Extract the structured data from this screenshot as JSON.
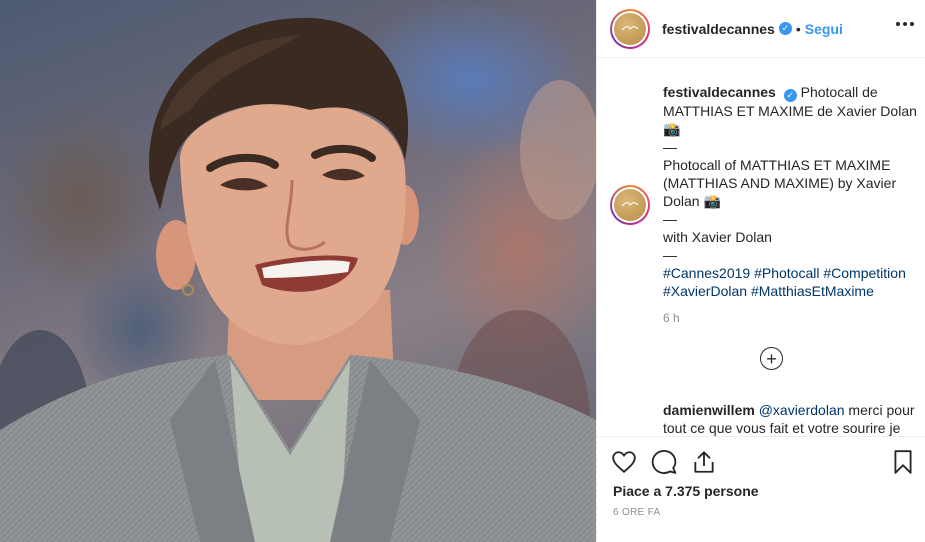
{
  "post": {
    "username": "festivaldecannes",
    "verified_icon": "verified-badge-icon",
    "separator": "•",
    "follow_label": "Segui",
    "more_icon": "more-options-icon"
  },
  "caption": {
    "username": "festivaldecannes",
    "line1": "Photocall de MATTHIAS ET MAXIME de Xavier Dolan",
    "emoji1": "📸",
    "dash1": "—",
    "line2": "Photocall of MATTHIAS ET MAXIME (MATTHIAS AND MAXIME) by Xavier Dolan",
    "emoji2": "📸",
    "dash2": "—",
    "line3": "with Xavier Dolan",
    "dash3": "—",
    "hashtags": [
      "#Cannes2019",
      "#Photocall",
      "#Competition",
      "#XavierDolan",
      "#MatthiasEtMaxime"
    ],
    "time": "6 h"
  },
  "load_more_icon": "plus-circle-icon",
  "comment": {
    "username": "damienwillem",
    "mention": "@xavierdolan",
    "text": "merci pour tout ce que vous fait et votre sourire je"
  },
  "actions": {
    "icons": [
      "heart-icon",
      "comment-icon",
      "share-icon",
      "bookmark-icon"
    ],
    "likes_prefix": "Piace a",
    "likes_count": "7.375",
    "likes_suffix": "persone",
    "date": "6 ORE FA"
  },
  "colors": {
    "link": "#3897f0",
    "hashtag": "#003569",
    "muted": "#8e8e8e"
  }
}
